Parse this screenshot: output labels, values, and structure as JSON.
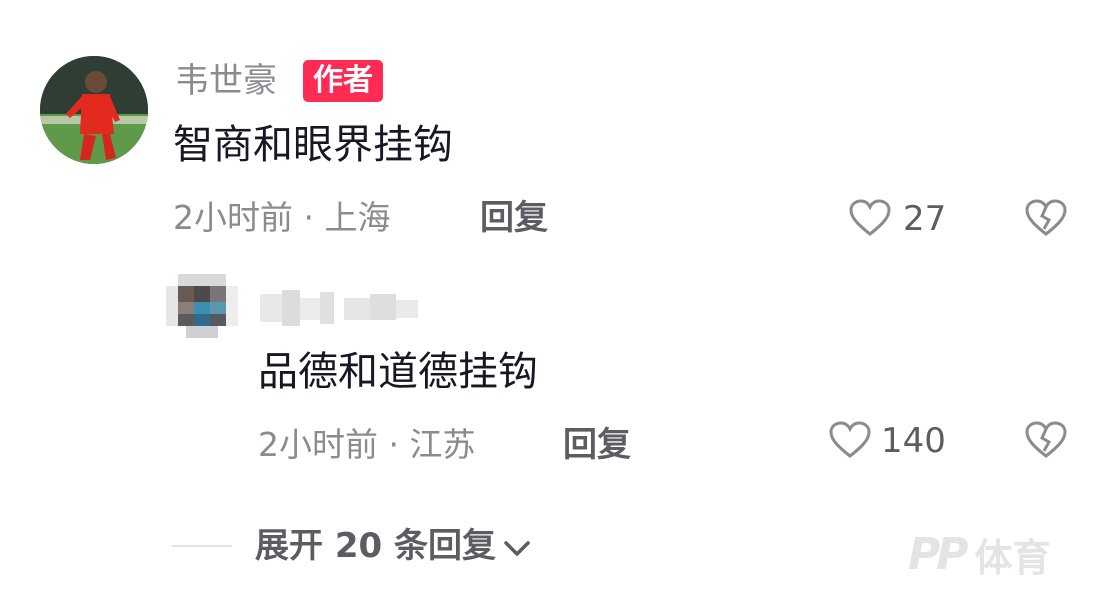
{
  "comment": {
    "author": "韦世豪",
    "badge": "作者",
    "text": "智商和眼界挂钩",
    "meta": "2小时前 · 上海",
    "reply_label": "回复",
    "likes": "27"
  },
  "reply": {
    "text": "品德和道德挂钩",
    "meta": "2小时前 · 江苏",
    "reply_label": "回复",
    "likes": "140"
  },
  "expand_label": "展开 20 条回复",
  "watermark": {
    "logo": "PP",
    "text": "体育"
  },
  "colors": {
    "badge": "#fe2c55",
    "secondary_text": "#8a8b91"
  }
}
